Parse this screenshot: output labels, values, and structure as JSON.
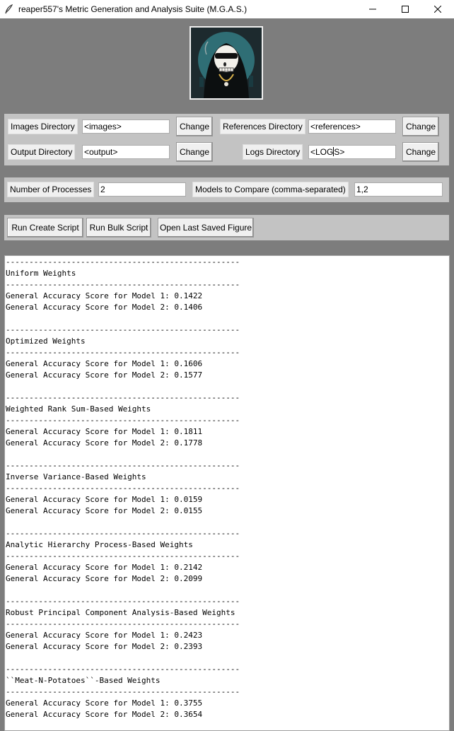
{
  "window": {
    "title": "reaper557's Metric Generation and Analysis Suite (M.G.A.S.)",
    "icons": [
      "feather-icon",
      "minimize-icon",
      "maximize-icon",
      "close-icon"
    ]
  },
  "logo": {
    "icon": "skull-reaper-logo"
  },
  "directories": {
    "images_label": "Images Directory",
    "images_value": "<images>",
    "references_label": "References Directory",
    "references_value": "<references>",
    "output_label": "Output Directory",
    "output_value": "<output>",
    "logs_label": "Logs Directory",
    "logs_value_before_cursor": "<LOG",
    "logs_value_after_cursor": "S>",
    "change_label": "Change"
  },
  "settings": {
    "processes_label": "Number of Processes",
    "processes_value": "2",
    "models_label": "Models to Compare (comma-separated)",
    "models_value": "1,2"
  },
  "actions": {
    "create_label": "Run Create Script",
    "bulk_label": "Run Bulk Script",
    "open_label": "Open Last Saved Figure"
  },
  "output": {
    "lines": [
      "--------------------------------------------------",
      "Uniform Weights",
      "--------------------------------------------------",
      "General Accuracy Score for Model 1: 0.1422",
      "General Accuracy Score for Model 2: 0.1406",
      "",
      "--------------------------------------------------",
      "Optimized Weights",
      "--------------------------------------------------",
      "General Accuracy Score for Model 1: 0.1606",
      "General Accuracy Score for Model 2: 0.1577",
      "",
      "--------------------------------------------------",
      "Weighted Rank Sum-Based Weights",
      "--------------------------------------------------",
      "General Accuracy Score for Model 1: 0.1811",
      "General Accuracy Score for Model 2: 0.1778",
      "",
      "--------------------------------------------------",
      "Inverse Variance-Based Weights",
      "--------------------------------------------------",
      "General Accuracy Score for Model 1: 0.0159",
      "General Accuracy Score for Model 2: 0.0155",
      "",
      "--------------------------------------------------",
      "Analytic Hierarchy Process-Based Weights",
      "--------------------------------------------------",
      "General Accuracy Score for Model 1: 0.2142",
      "General Accuracy Score for Model 2: 0.2099",
      "",
      "--------------------------------------------------",
      "Robust Principal Component Analysis-Based Weights",
      "--------------------------------------------------",
      "General Accuracy Score for Model 1: 0.2423",
      "General Accuracy Score for Model 2: 0.2393",
      "",
      "--------------------------------------------------",
      "``Meat-N-Potatoes``-Based Weights",
      "--------------------------------------------------",
      "General Accuracy Score for Model 1: 0.3755",
      "General Accuracy Score for Model 2: 0.3654"
    ]
  }
}
